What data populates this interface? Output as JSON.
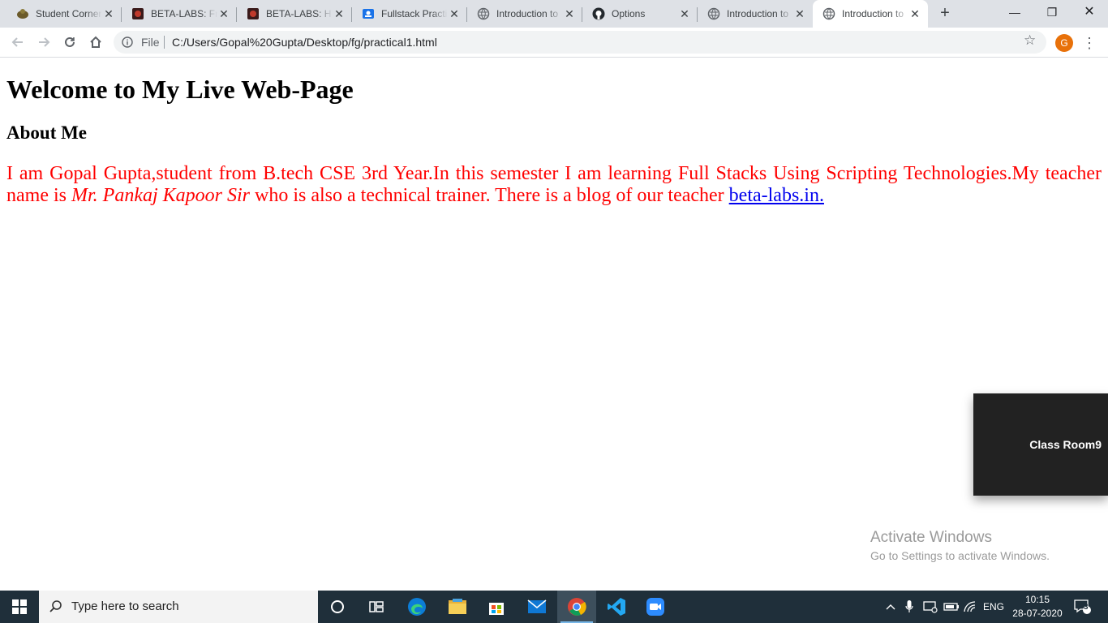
{
  "browser": {
    "tabs": [
      {
        "title": "Student Corner",
        "favicon": "student-icon"
      },
      {
        "title": "BETA-LABS: From",
        "favicon": "betalabs-icon"
      },
      {
        "title": "BETA-LABS: HTML",
        "favicon": "betalabs-icon"
      },
      {
        "title": "Fullstack Practical",
        "favicon": "classroom-icon"
      },
      {
        "title": "Introduction to",
        "favicon": "globe-icon"
      },
      {
        "title": "Options",
        "favicon": "github-icon"
      },
      {
        "title": "Introduction to",
        "favicon": "globe-icon"
      },
      {
        "title": "Introduction to",
        "favicon": "globe-icon",
        "active": true
      }
    ],
    "new_tab_label": "+",
    "window_controls": {
      "minimize": "—",
      "restore": "❐",
      "close": "✕"
    },
    "address": {
      "scheme_label": "File",
      "url": "C:/Users/Gopal%20Gupta/Desktop/fg/practical1.html"
    },
    "avatar_letter": "G"
  },
  "page": {
    "heading": "Welcome to My Live Web-Page",
    "subheading": "About Me",
    "paragraph": {
      "part1": "I am Gopal Gupta,student from B.tech CSE 3rd Year.In this semester I am learning Full Stacks Using Scripting Technologies.My teacher name is ",
      "teacher": "Mr. Pankaj Kapoor Sir",
      "part2": " who is also a technical trainer. There is a blog of our teacher ",
      "link_text": "beta-labs.in."
    }
  },
  "overlays": {
    "zoom_participant": "Class Room9",
    "activate_title": "Activate Windows",
    "activate_subtitle": "Go to Settings to activate Windows."
  },
  "taskbar": {
    "search_placeholder": "Type here to search",
    "apps": [
      "cortana-icon",
      "task-view-icon",
      "edge-icon",
      "file-explorer-icon",
      "store-icon",
      "mail-icon",
      "chrome-icon",
      "vscode-icon",
      "zoom-icon"
    ],
    "language": "ENG",
    "time": "10:15",
    "date": "28-07-2020",
    "notification_count": "3"
  }
}
